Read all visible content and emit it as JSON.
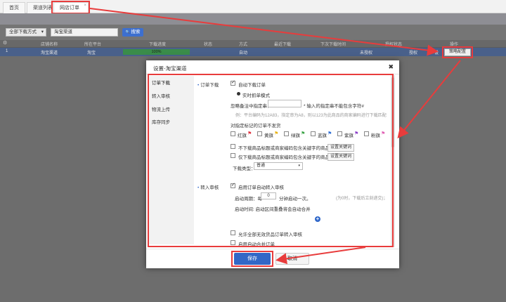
{
  "tabs": [
    {
      "label": "首页"
    },
    {
      "label": "渠道列表"
    },
    {
      "label": "网店订单下载",
      "close": "×"
    }
  ],
  "filter": {
    "mode_label": "全部下载方式",
    "mode_caret": "▾",
    "channel_value": "淘宝渠道",
    "search_label": "搜索",
    "search_icon": "🔍"
  },
  "grid": {
    "settings_icon": "⚙",
    "headers": [
      "店铺名称",
      "所在平台",
      "下载进度",
      "状态",
      "方式",
      "最近下载",
      "下次下载时间",
      "授权状态",
      "操作"
    ],
    "row": {
      "index": "1",
      "shop": "淘宝渠道",
      "platform": "淘宝",
      "progress_pct": 100,
      "progress_label": "100%",
      "mode": "自动",
      "auth": "未授权",
      "op_auth": "授权",
      "op_b": "设",
      "strategy_label": "策略配置"
    }
  },
  "modal": {
    "title": "设置-淘宝渠道",
    "close": "✖",
    "side_items": [
      "订单下载",
      "转入审核",
      "物流上传",
      "库存同步"
    ],
    "section1": {
      "title": "订单下载",
      "auto_download": "自动下载订单",
      "realtime": "实时抓单模式",
      "filter_label": "忽略备注中指定串：",
      "filter_note": "* 输入的指定串不能包含字符#",
      "example": "例：平台编码为12A83，指定串为A8，则以123为此商品的商家编码进行下载匹配",
      "flag_intro": "对指定标记的订单不发货",
      "flags": [
        {
          "label": "红旗",
          "color": "#e0313f"
        },
        {
          "label": "黄旗",
          "color": "#e9b313"
        },
        {
          "label": "绿旗",
          "color": "#3aa345"
        },
        {
          "label": "蓝旗",
          "color": "#2f6ed6"
        },
        {
          "label": "紫旗",
          "color": "#8b3fc9"
        },
        {
          "label": "粉旗",
          "color": "#e05fb4"
        }
      ],
      "flag_icon": "⚑",
      "kw1": "不下载商品标题或商家编码包含关键字的商品",
      "kw2": "仅下载商品标题或商家编码包含关键字的商品",
      "kw_btn": "设置关键词",
      "type_label": "下载类型：",
      "type_value": "普通",
      "type_caret": "▾"
    },
    "section2": {
      "title": "转入审核",
      "enable": "启用订单自动转入审核",
      "period_label": "启动周期：每",
      "period_value": "0",
      "period_unit": "分钟启动一次。",
      "period_note": "(为0时，下载后立刻递交)；",
      "time_label": "启动时间: 启动区间重叠将会自动合并",
      "add_icon": "+",
      "allow": "允许全部无效货品订单转入审核",
      "auto_merge": "启用自动合并订单"
    },
    "save": "保存",
    "cancel": "取消"
  },
  "colors": {
    "annotation": "#e83c3c",
    "primary": "#3267c6"
  }
}
